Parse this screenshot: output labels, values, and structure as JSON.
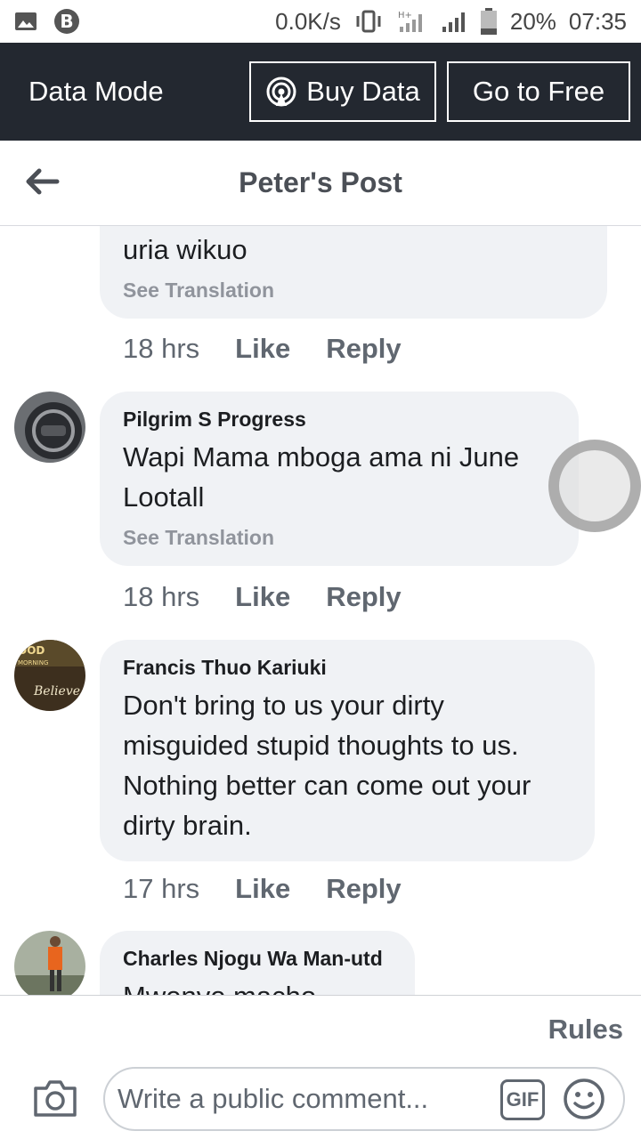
{
  "status_bar": {
    "speed": "0.0K/s",
    "battery": "20%",
    "time": "07:35"
  },
  "data_mode": {
    "title": "Data Mode",
    "buy_data_label": "Buy Data",
    "go_to_free_label": "Go to Free"
  },
  "header": {
    "title": "Peter's Post"
  },
  "comments": [
    {
      "text": "uria wikuo",
      "translate": "See Translation",
      "time": "18 hrs",
      "like": "Like",
      "reply": "Reply"
    },
    {
      "author": "Pilgrim S Progress",
      "text_line1": "Wapi Mama mboga ama ni June",
      "text_line2": "Lootall",
      "translate": "See Translation",
      "time": "18 hrs",
      "like": "Like",
      "reply": "Reply"
    },
    {
      "author": "Francis Thuo Kariuki",
      "text_line1": "Don't bring to us your dirty",
      "text_line2": "misguided stupid thoughts to us.",
      "text_line3": "Nothing better can come out your",
      "text_line4": "dirty brain.",
      "time": "17 hrs",
      "like": "Like",
      "reply": "Reply"
    },
    {
      "author": "Charles Njogu Wa Man-utd",
      "text": "Mwenye macho"
    }
  ],
  "composer": {
    "rules": "Rules",
    "placeholder": "Write a public comment...",
    "gif_label": "GIF"
  }
}
